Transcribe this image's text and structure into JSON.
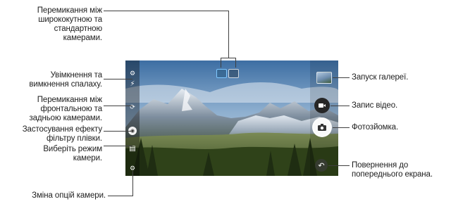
{
  "callouts": {
    "lens_switch": "Перемикання між ширококутною та стандартною камерами.",
    "flash": "Увімкнення та вимкнення спалаху.",
    "front_rear": "Перемикання між фронтальною та задньою камерами.",
    "film_effect": "Застосування ефекту фільтру плівки.",
    "camera_mode": "Виберіть режим камери.",
    "camera_options": "Зміна опцій камери.",
    "gallery": "Запуск галереї.",
    "record_video": "Запис відео.",
    "take_photo": "Фотозйомка.",
    "go_back": "Повернення до попереднього екрана."
  },
  "lines_text": {
    "lens_switch": [
      "Перемикання між",
      "ширококутною та",
      "стандартною",
      "камерами."
    ],
    "flash": [
      "Увімкнення та",
      "вимкнення спалаху."
    ],
    "front_rear": [
      "Перемикання між",
      "фронтальною та",
      "задньою камерами."
    ],
    "film_effect": [
      "Застосування ефекту",
      "фільтру плівки."
    ],
    "camera_mode": [
      "Виберіть режим",
      "камери."
    ],
    "camera_options": [
      "Зміна опцій камери."
    ],
    "gallery": [
      "Запуск галереї."
    ],
    "record_video": [
      "Запис відео."
    ],
    "take_photo": [
      "Фотозйомка."
    ],
    "go_back": [
      "Повернення до",
      "попереднього екрана."
    ]
  },
  "icons": {
    "flash": "flash-icon",
    "front_rear": "switch-camera-icon",
    "film_effect": "film-filter-icon",
    "camera_mode": "mode-icon",
    "camera_options": "settings-icon",
    "lens_wide": "wide-angle-icon",
    "lens_standard": "standard-lens-icon",
    "gallery": "gallery-thumbnail",
    "record_video": "video-record-icon",
    "take_photo": "shutter-icon",
    "go_back": "back-icon"
  },
  "colors": {
    "line": "#3f3f3f",
    "text": "#1e1e1e",
    "lens_highlight": "#7fc8ff"
  }
}
